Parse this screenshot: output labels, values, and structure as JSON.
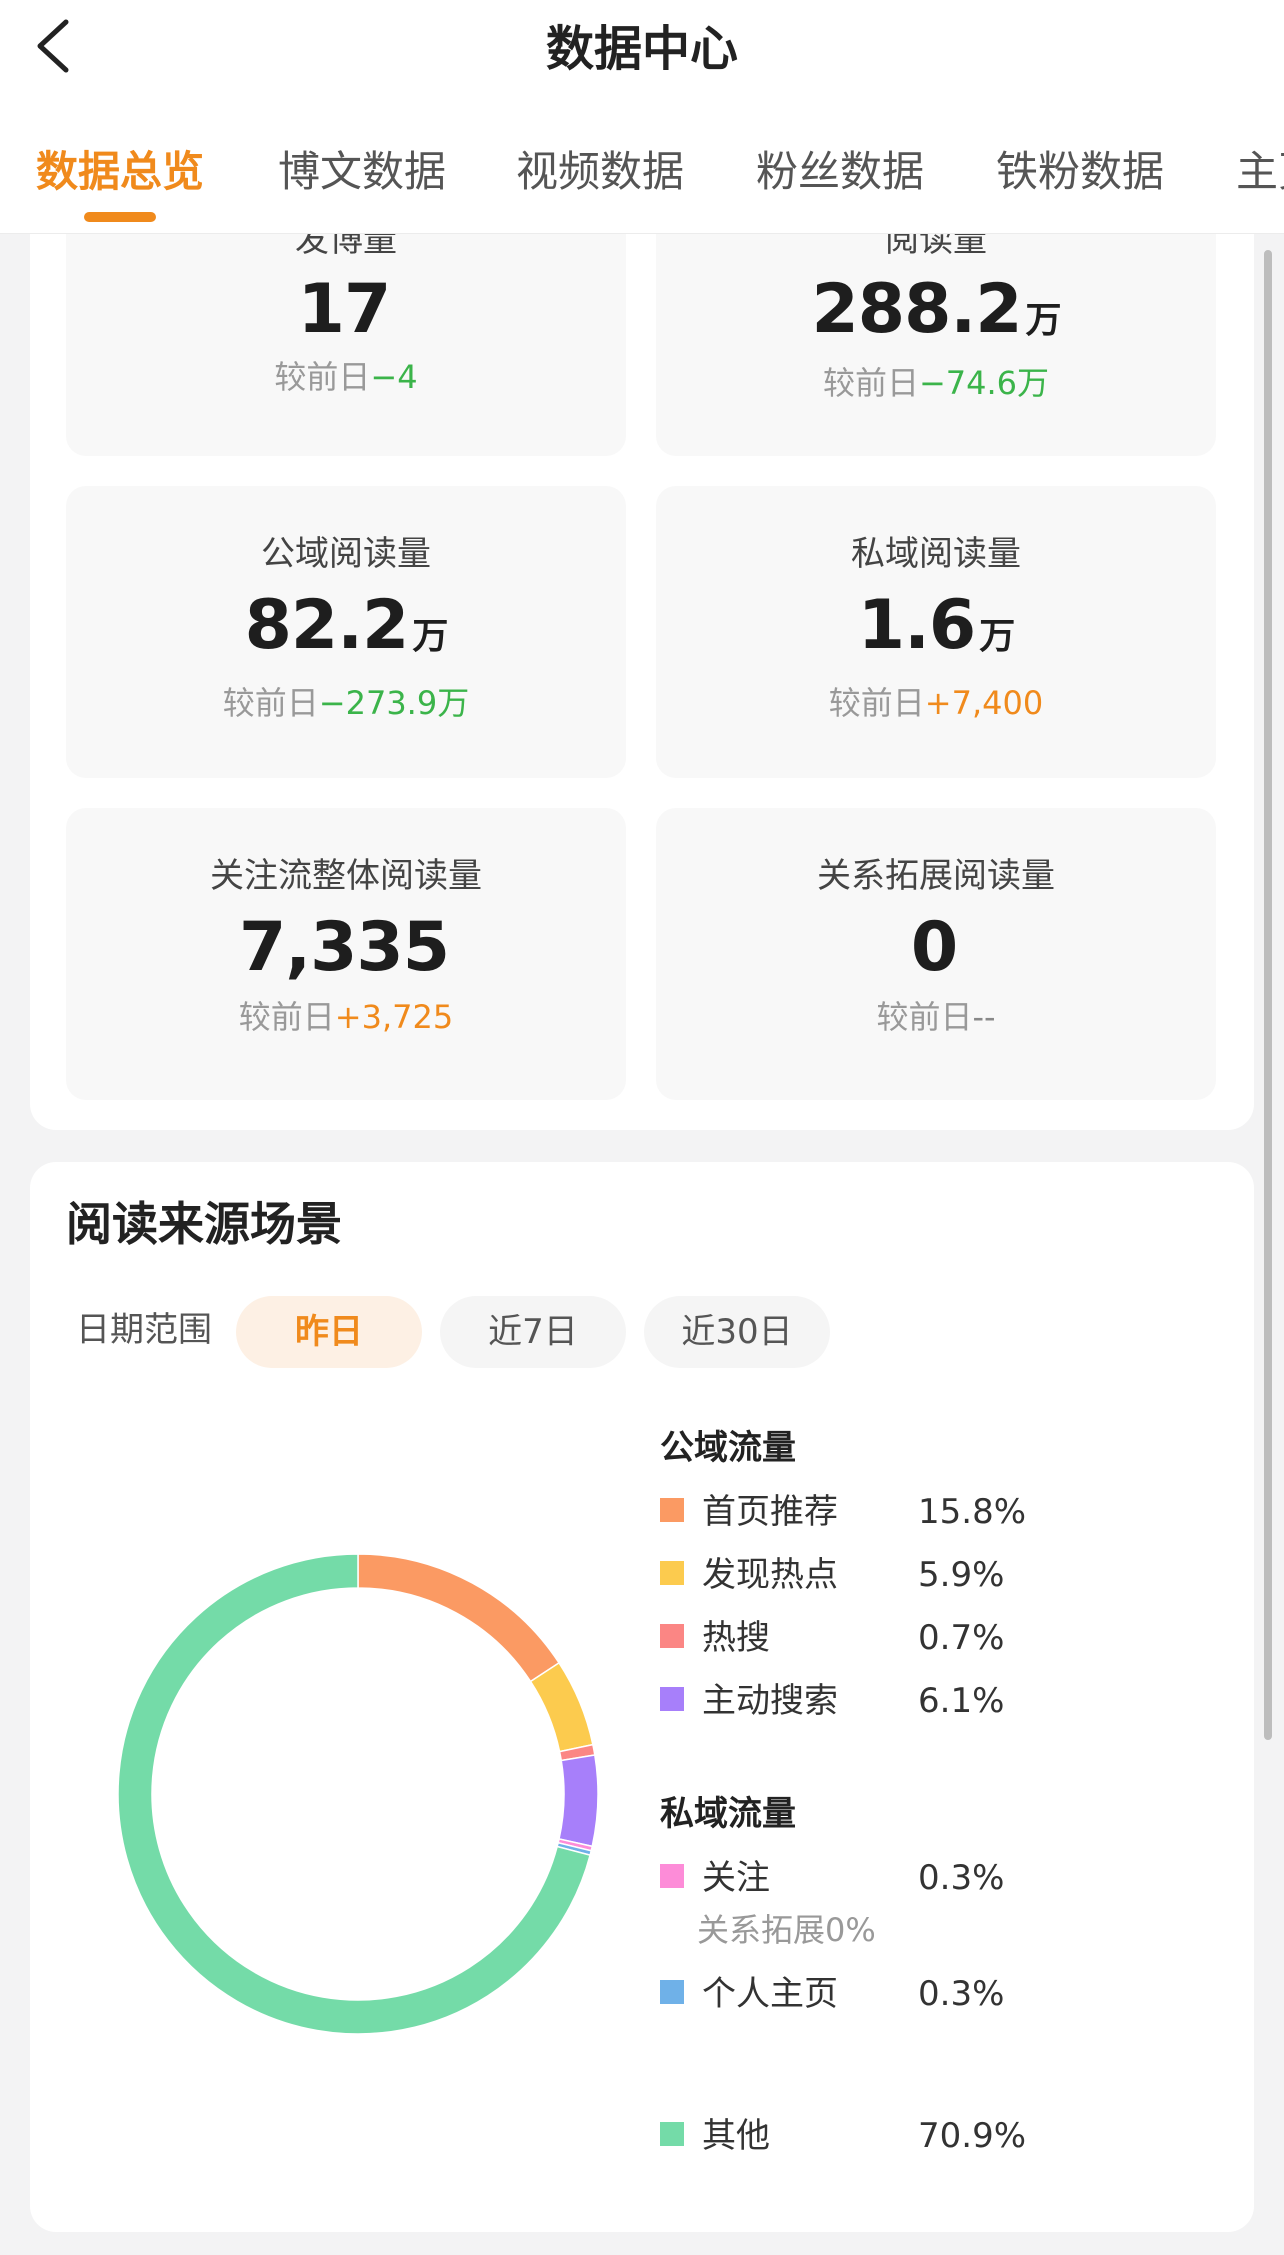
{
  "nav": {
    "title": "数据中心"
  },
  "tabs": [
    {
      "label": "数据总览",
      "active": true
    },
    {
      "label": "博文数据"
    },
    {
      "label": "视频数据"
    },
    {
      "label": "粉丝数据"
    },
    {
      "label": "铁粉数据"
    },
    {
      "label": "主页"
    }
  ],
  "metrics": [
    {
      "label": "发博量",
      "value": "17",
      "unit": "",
      "change_prefix": "较前日",
      "change": "−4",
      "trend": "down"
    },
    {
      "label": "阅读量",
      "value": "288.2",
      "unit": "万",
      "change_prefix": "较前日",
      "change": "−74.6万",
      "trend": "down"
    },
    {
      "label": "公域阅读量",
      "value": "82.2",
      "unit": "万",
      "change_prefix": "较前日",
      "change": "−273.9万",
      "trend": "down"
    },
    {
      "label": "私域阅读量",
      "value": "1.6",
      "unit": "万",
      "change_prefix": "较前日",
      "change": "+7,400",
      "trend": "up"
    },
    {
      "label": "关注流整体阅读量",
      "value": "7,335",
      "unit": "",
      "change_prefix": "较前日",
      "change": "+3,725",
      "trend": "up"
    },
    {
      "label": "关系拓展阅读量",
      "value": "0",
      "unit": "",
      "change_prefix": "较前日",
      "change": "--",
      "trend": "flat"
    }
  ],
  "colors": {
    "accent": "#f08a1c",
    "down": "#3bb44a",
    "up": "#f08a1c"
  },
  "source": {
    "title": "阅读来源场景",
    "range_label": "日期范围",
    "ranges": [
      {
        "label": "昨日",
        "active": true
      },
      {
        "label": "近7日"
      },
      {
        "label": "近30日"
      }
    ],
    "public_title": "公域流量",
    "private_title": "私域流量",
    "relation_note": "关系拓展0%"
  },
  "chart_data": {
    "type": "pie",
    "categories": [
      "首页推荐",
      "发现热点",
      "热搜",
      "主动搜索",
      "关注",
      "个人主页",
      "其他"
    ],
    "values": [
      15.8,
      5.9,
      0.7,
      6.1,
      0.3,
      0.3,
      70.9
    ],
    "labels": [
      "15.8%",
      "5.9%",
      "0.7%",
      "6.1%",
      "0.3%",
      "0.3%",
      "70.9%"
    ],
    "colors": [
      "#fb9a63",
      "#fccb4e",
      "#fb8684",
      "#a77ffa",
      "#fd8cd8",
      "#6fb1e8",
      "#74dba8"
    ]
  }
}
